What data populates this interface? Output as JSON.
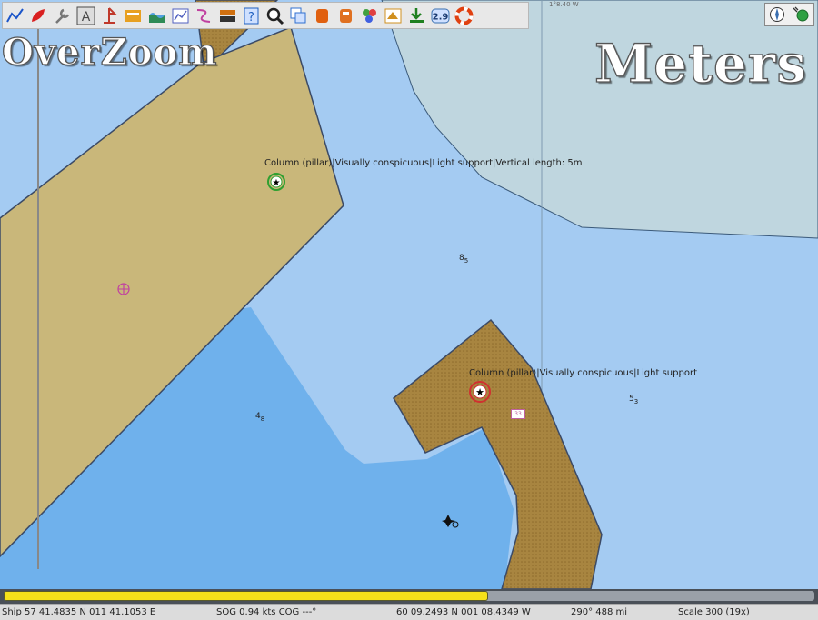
{
  "toolbar": {
    "tools": [
      {
        "name": "route-icon",
        "color": "#1b55c9"
      },
      {
        "name": "ship-icon",
        "color": "#d92020"
      },
      {
        "name": "wrench-icon",
        "color": "#777777"
      },
      {
        "name": "text-icon",
        "color": "#4a4a4a"
      },
      {
        "name": "mark-icon",
        "color": "#c0392b"
      },
      {
        "name": "chart-icon",
        "color": "#e8a020"
      },
      {
        "name": "tide-icon",
        "color": "#2e8b57"
      },
      {
        "name": "dashboard-icon",
        "color": "#5060c0"
      },
      {
        "name": "track-icon",
        "color": "#c040a0"
      },
      {
        "name": "layers-icon",
        "color": "#d07010"
      },
      {
        "name": "help-icon",
        "color": "#2060c0"
      },
      {
        "name": "zoom-icon",
        "color": "#222222"
      },
      {
        "name": "copy-icon",
        "color": "#3070d0"
      },
      {
        "name": "orange-bucket-icon",
        "color": "#e06010"
      },
      {
        "name": "orange-bucket2-icon",
        "color": "#e07020"
      },
      {
        "name": "color-scheme-icon",
        "color": "#40a040"
      },
      {
        "name": "weather-icon",
        "color": "#d09020"
      },
      {
        "name": "download-icon",
        "color": "#208020"
      },
      {
        "name": "version-icon",
        "color": "#3a6fb0"
      },
      {
        "name": "lifebuoy-icon",
        "color": "#e04010"
      }
    ],
    "version_text": "2.9"
  },
  "overlay": {
    "overzoom": "OverZoom",
    "units": "Meters",
    "longitude_grid": "1°8.40 W"
  },
  "map_labels": {
    "light1": "Column (pillar)|Visually conspicuous|Light support|Vertical length: 5m",
    "light2": "Column (pillar)|Visually conspicuous|Light support",
    "sounding1": {
      "value": "8",
      "sub": "5"
    },
    "sounding2": {
      "value": "4",
      "sub": "8"
    },
    "sounding3": {
      "value": "5",
      "sub": "3"
    },
    "tag": "33"
  },
  "colors": {
    "land": "#c9b77a",
    "shallow": "#a4cbf2",
    "deep": "#6fb1ec",
    "drying": "#bfd6df"
  },
  "progress": {
    "fraction": 0.598
  },
  "status": {
    "ship": "Ship 57 41.4835 N   011 41.1053 E",
    "sog": "SOG 0.94 kts  COG ---°",
    "cursor": "60 09.2493 N   001 08.4349 W",
    "bearing": "290°  488 mi",
    "scale": "Scale  300 (19x)"
  }
}
